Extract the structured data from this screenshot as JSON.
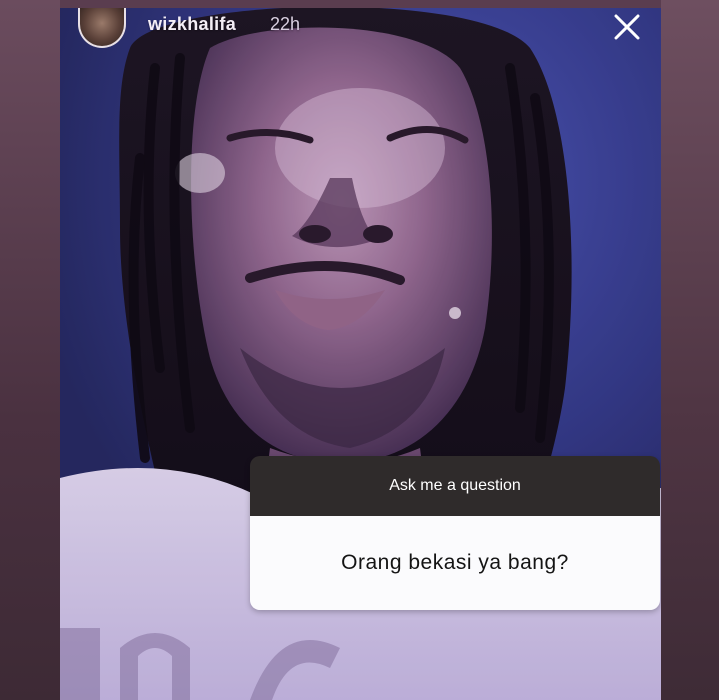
{
  "story": {
    "username": "wizkhalifa",
    "time_ago": "22h",
    "close_icon": "close-icon"
  },
  "question_sticker": {
    "prompt": "Ask me a question",
    "answer": "Orang bekasi ya bang?"
  },
  "colors": {
    "sticker_header_bg": "#2f2b2b",
    "sticker_body_bg": "#fbfbfd",
    "background": "#3b3f86"
  }
}
